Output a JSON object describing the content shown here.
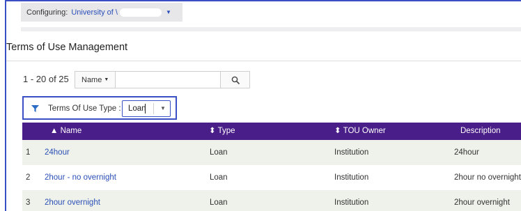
{
  "config_bar": {
    "label": "Configuring:",
    "value": "University of \\",
    "caret": "▼"
  },
  "page": {
    "title": "Terms of Use Management"
  },
  "search": {
    "range_text": "1 - 20 of 25",
    "field_select": "Name",
    "field_caret": "▼",
    "query_value": ""
  },
  "filter": {
    "label": "Terms Of Use Type :",
    "value": "Loan"
  },
  "table": {
    "headers": {
      "name": "▲ Name",
      "type": "⬍ Type",
      "owner": "⬍ TOU Owner",
      "description": "Description"
    },
    "rows": [
      {
        "num": "1",
        "name": "24hour",
        "type": "Loan",
        "owner": "Institution",
        "description": "24hour"
      },
      {
        "num": "2",
        "name": "2hour - no overnight",
        "type": "Loan",
        "owner": "Institution",
        "description": "2hour no overnight"
      },
      {
        "num": "3",
        "name": "2hour overnight",
        "type": "Loan",
        "owner": "Institution",
        "description": "2hour overnight"
      }
    ]
  },
  "colors": {
    "header_bg": "#4a1e88",
    "link": "#2b4fb8",
    "highlight_border": "#3b4fc4",
    "row_alt": "#eef2ea"
  },
  "icons": [
    "search-icon",
    "filter-funnel-icon",
    "chevron-down-icon",
    "sort-ascending-icon",
    "sort-icon"
  ]
}
